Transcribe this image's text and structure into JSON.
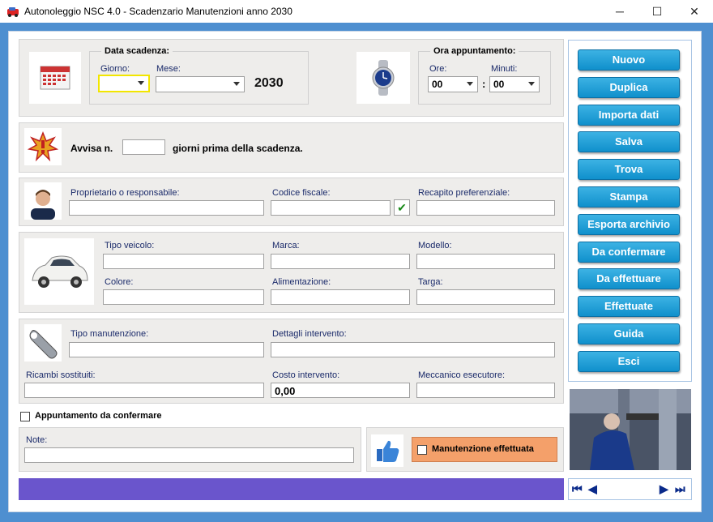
{
  "window": {
    "title": "Autonoleggio NSC 4.0 - Scadenzario Manutenzioni anno 2030",
    "min_glyph": "─",
    "max_glyph": "☐",
    "close_glyph": "✕"
  },
  "date_section": {
    "title": "Data scadenza:",
    "day_label": "Giorno:",
    "day_value": "",
    "month_label": "Mese:",
    "month_value": "",
    "year": "2030"
  },
  "time_section": {
    "title": "Ora appuntamento:",
    "hours_label": "Ore:",
    "hours_value": "00",
    "minutes_label": "Minuti:",
    "minutes_value": "00",
    "separator": ":"
  },
  "alert": {
    "prefix": "Avvisa n.",
    "value": "",
    "suffix": "giorni prima della scadenza."
  },
  "owner": {
    "owner_label": "Proprietario o responsabile:",
    "owner_value": "",
    "tax_code_label": "Codice fiscale:",
    "tax_code_value": "",
    "verify_glyph": "✔",
    "contact_label": "Recapito preferenziale:",
    "contact_value": ""
  },
  "vehicle": {
    "type_label": "Tipo veicolo:",
    "type_value": "",
    "brand_label": "Marca:",
    "brand_value": "",
    "model_label": "Modello:",
    "model_value": "",
    "color_label": "Colore:",
    "color_value": "",
    "fuel_label": "Alimentazione:",
    "fuel_value": "",
    "plate_label": "Targa:",
    "plate_value": ""
  },
  "maintenance": {
    "type_label": "Tipo manutenzione:",
    "type_value": "",
    "details_label": "Dettagli intervento:",
    "details_value": "",
    "parts_label": "Ricambi sostituiti:",
    "parts_value": "",
    "cost_label": "Costo intervento:",
    "cost_value": "0,00",
    "mechanic_label": "Meccanico esecutore:",
    "mechanic_value": ""
  },
  "to_confirm_label": "Appuntamento da confermare",
  "notes": {
    "label": "Note:",
    "value": ""
  },
  "done_label": "Manutenzione effettuata",
  "buttons": [
    "Nuovo",
    "Duplica",
    "Importa dati",
    "Salva",
    "Trova",
    "Stampa",
    "Esporta archivio",
    "Da confermare",
    "Da effettuare",
    "Effettuate",
    "Guida",
    "Esci"
  ],
  "nav": {
    "first": "⏮",
    "prev": "◀",
    "next": "▶",
    "last": "⏭"
  },
  "colors": {
    "frame": "#4e8fd0",
    "button": "#1a9cd6",
    "status_bar": "#6a55cc",
    "done_box": "#f4a06a"
  }
}
